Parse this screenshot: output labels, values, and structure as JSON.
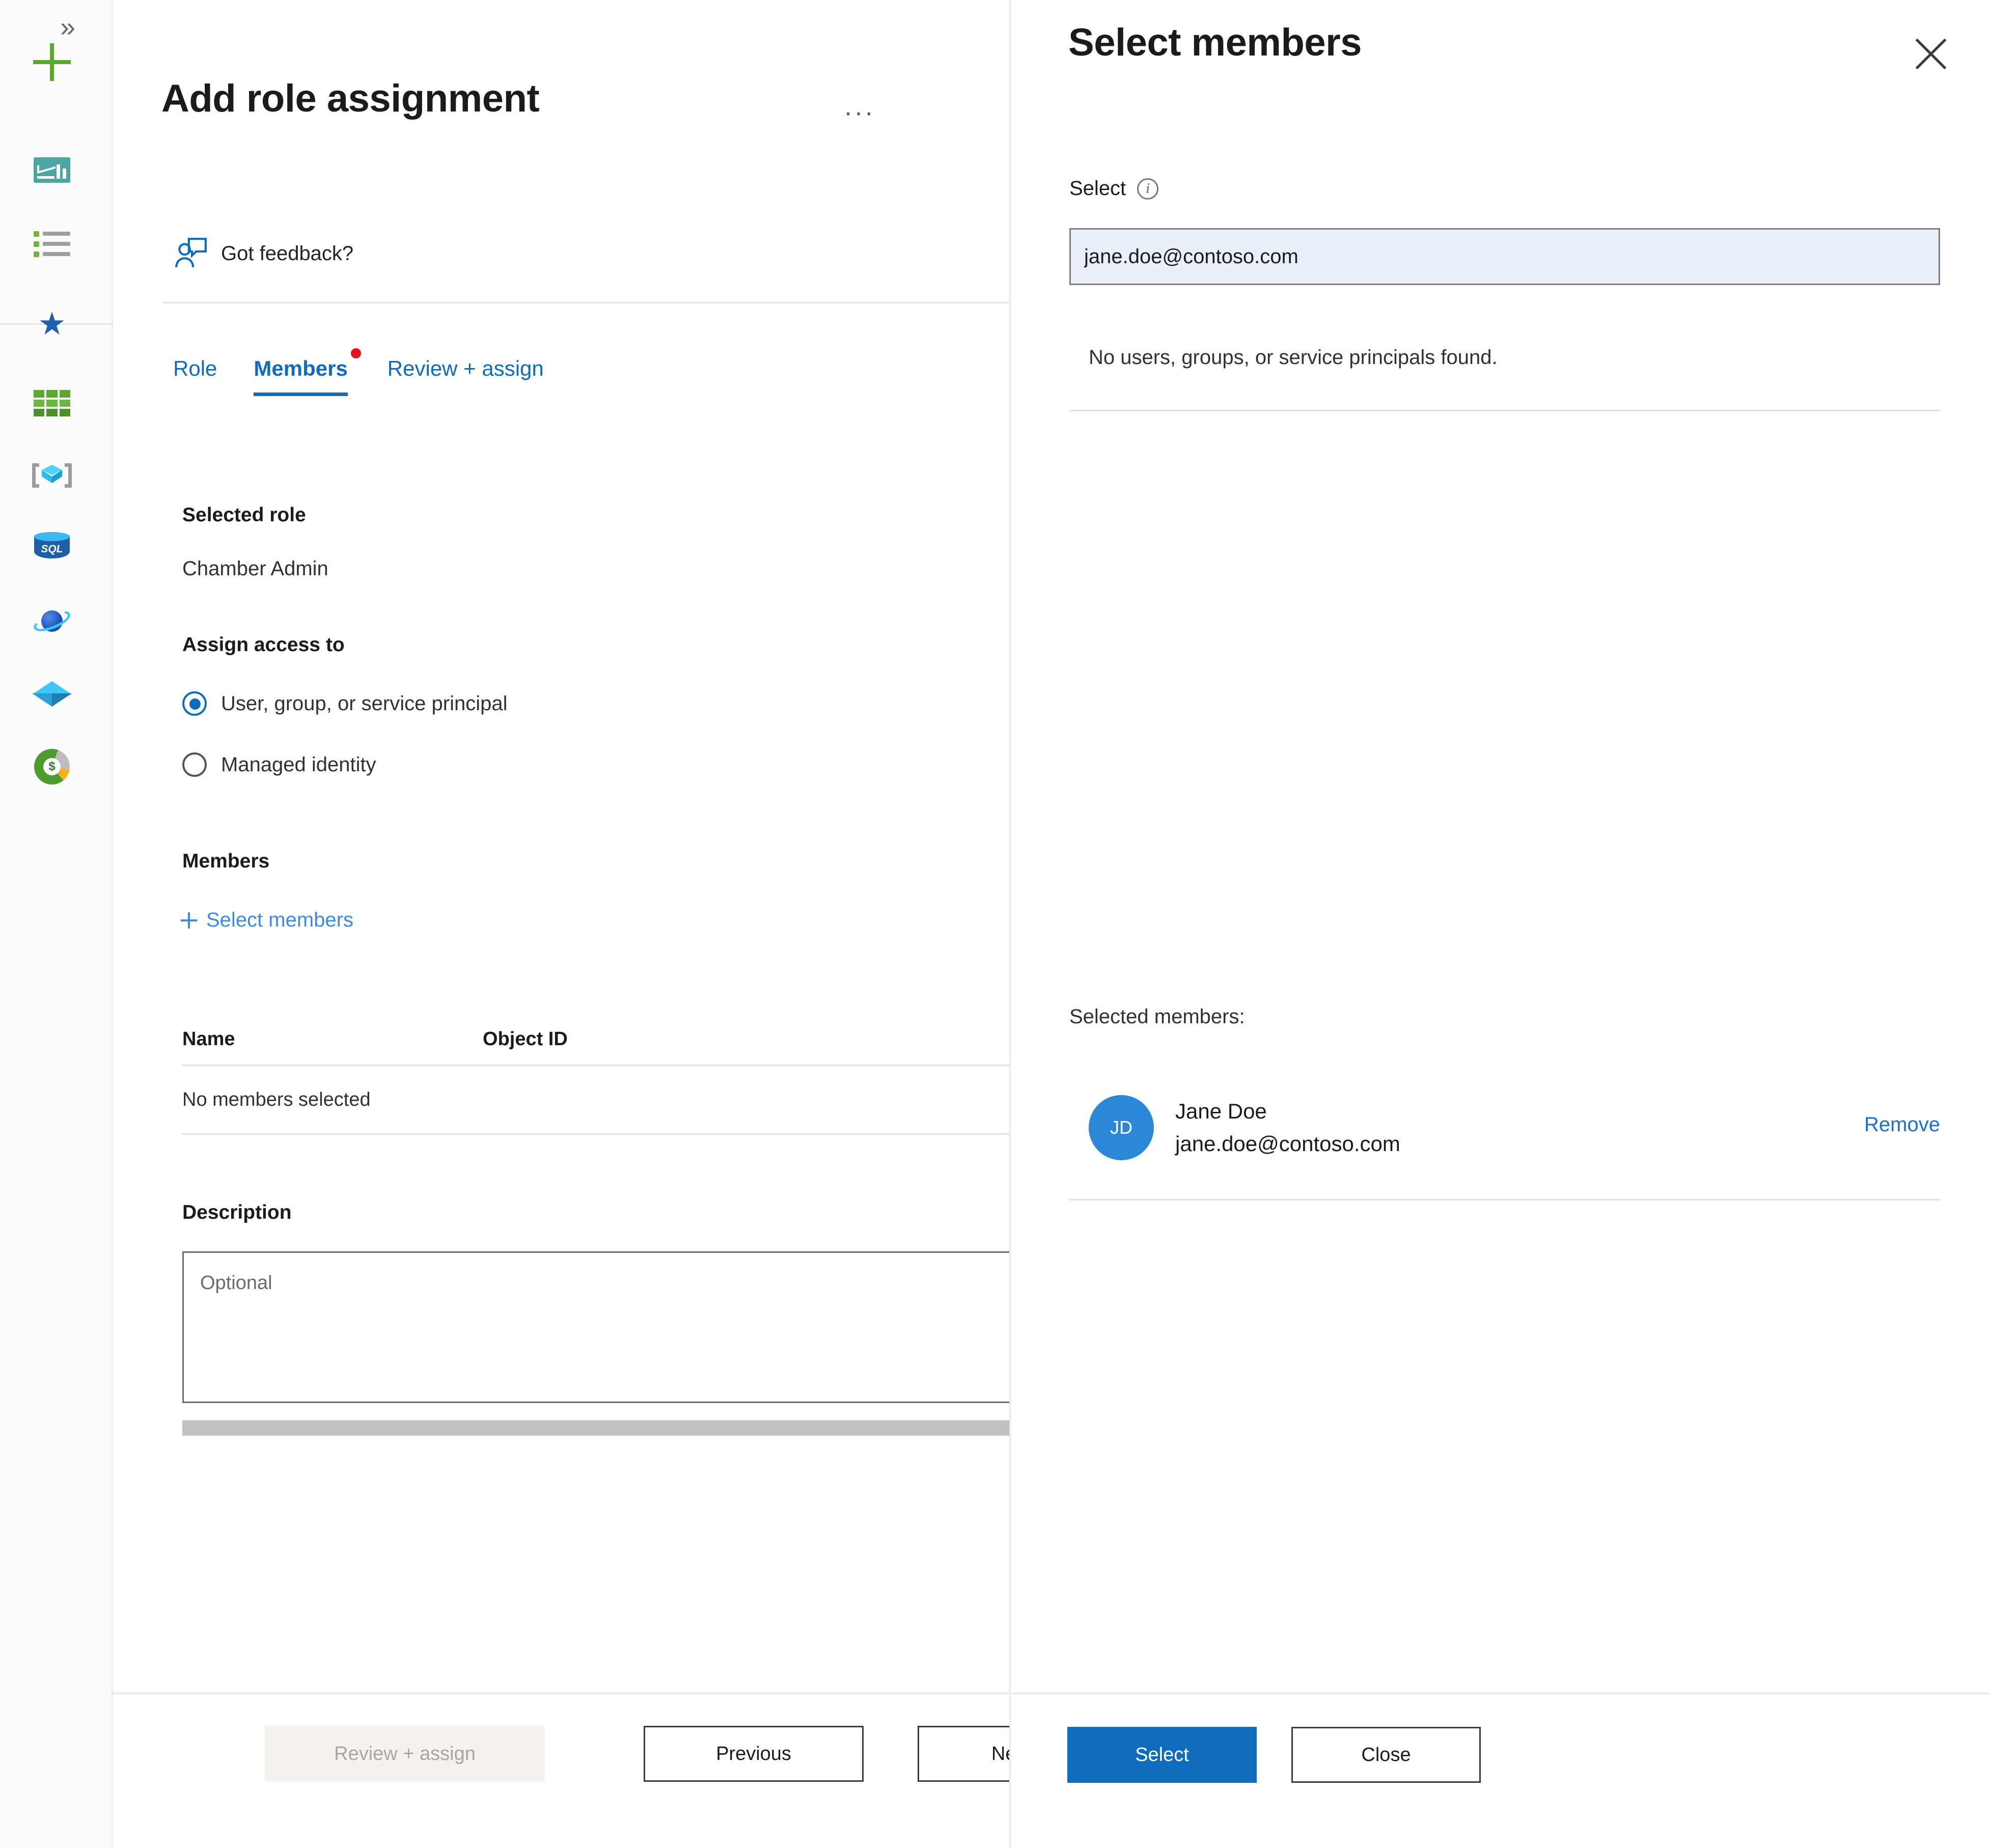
{
  "sidebar": {
    "expand_chevron": "»",
    "items": [
      {
        "name": "create-resource",
        "icon": "plus-icon"
      },
      {
        "name": "dashboard",
        "icon": "dashboard-icon"
      },
      {
        "name": "all-services",
        "icon": "list-icon"
      },
      {
        "name": "favorites",
        "icon": "star-icon"
      },
      {
        "name": "resource-groups",
        "icon": "grid-icon"
      },
      {
        "name": "app-services",
        "icon": "cube-icon"
      },
      {
        "name": "sql-databases",
        "icon": "sql-database-icon",
        "label": "SQL"
      },
      {
        "name": "cosmos-db",
        "icon": "cosmos-db-icon"
      },
      {
        "name": "data-explorer",
        "icon": "diamond-icon"
      },
      {
        "name": "cost-management",
        "icon": "cost-donut-icon",
        "label": "$"
      }
    ]
  },
  "left_blade": {
    "title": "Add role assignment",
    "ellipsis": "···",
    "feedback_label": "Got feedback?",
    "tabs": [
      {
        "label": "Role",
        "active": false,
        "badge": false
      },
      {
        "label": "Members",
        "active": true,
        "badge": true
      },
      {
        "label": "Review + assign",
        "active": false,
        "badge": false
      }
    ],
    "selected_role_label": "Selected role",
    "selected_role_value": "Chamber Admin",
    "assign_access_label": "Assign access to",
    "radio_options": [
      {
        "label": "User, group, or service principal",
        "checked": true
      },
      {
        "label": "Managed identity",
        "checked": false
      }
    ],
    "members_label": "Members",
    "select_members_link": "Select members",
    "table": {
      "columns": [
        "Name",
        "Object ID"
      ],
      "empty_message": "No members selected"
    },
    "description_label": "Description",
    "description_placeholder": "Optional",
    "description_value": "",
    "footer": {
      "review_assign": "Review + assign",
      "previous": "Previous",
      "next": "Next"
    }
  },
  "right_blade": {
    "title": "Select members",
    "close_icon": "close-icon",
    "select_label": "Select",
    "info_icon": "info-icon",
    "search_value": "jane.doe@contoso.com",
    "search_placeholder": "",
    "no_results_message": "No users, groups, or service principals found.",
    "selected_members_label": "Selected members:",
    "selected_members": [
      {
        "initials": "JD",
        "name": "Jane Doe",
        "email": "jane.doe@contoso.com",
        "remove_label": "Remove"
      }
    ],
    "footer": {
      "select": "Select",
      "close": "Close"
    }
  },
  "colors": {
    "accent": "#0f6cbd",
    "link": "#3f8ae0",
    "badge": "#e81123",
    "avatar": "#2b88d8",
    "input_focus_bg": "#e9eef9"
  }
}
